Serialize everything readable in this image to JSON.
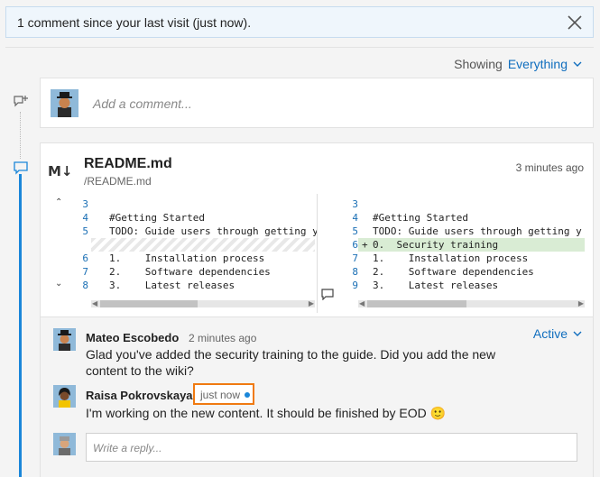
{
  "banner": {
    "text": "1 comment since your last visit (just now)."
  },
  "filter": {
    "label": "Showing",
    "value": "Everything"
  },
  "add_comment": {
    "placeholder": "Add a comment..."
  },
  "file": {
    "name": "README.md",
    "path": "/README.md",
    "time": "3 minutes ago"
  },
  "diff": {
    "left": [
      {
        "ln": "3",
        "code": ""
      },
      {
        "ln": "4",
        "code": "#Getting Started"
      },
      {
        "ln": "5",
        "code": "TODO: Guide users through getting y"
      },
      {
        "ln": "",
        "code": ""
      },
      {
        "ln": "6",
        "code": "1.    Installation process"
      },
      {
        "ln": "7",
        "code": "2.    Software dependencies"
      },
      {
        "ln": "8",
        "code": "3.    Latest releases"
      }
    ],
    "right": [
      {
        "ln": "3",
        "mk": "",
        "code": ""
      },
      {
        "ln": "4",
        "mk": "",
        "code": "#Getting Started"
      },
      {
        "ln": "5",
        "mk": "",
        "code": "TODO: Guide users through getting y"
      },
      {
        "ln": "6",
        "mk": "+",
        "code": "0.  Security training"
      },
      {
        "ln": "7",
        "mk": "",
        "code": "1.    Installation process"
      },
      {
        "ln": "8",
        "mk": "",
        "code": "2.    Software dependencies"
      },
      {
        "ln": "9",
        "mk": "",
        "code": "3.    Latest releases"
      }
    ]
  },
  "thread": {
    "status": "Active",
    "comments": [
      {
        "author": "Mateo Escobedo",
        "time": "2 minutes ago",
        "text": "Glad you've added the security training to the guide. Did you add the new content to the wiki?"
      },
      {
        "author": "Raisa Pokrovskaya",
        "time": "just now",
        "text": "I'm working on the new content. It should be finished by EOD",
        "emoji": "🙂"
      }
    ],
    "reply_placeholder": "Write a reply..."
  },
  "colors": {
    "accent": "#106ebe",
    "timeline": "#1a86d9",
    "highlight": "#f07a11",
    "added_line": "#d9ecd4"
  }
}
